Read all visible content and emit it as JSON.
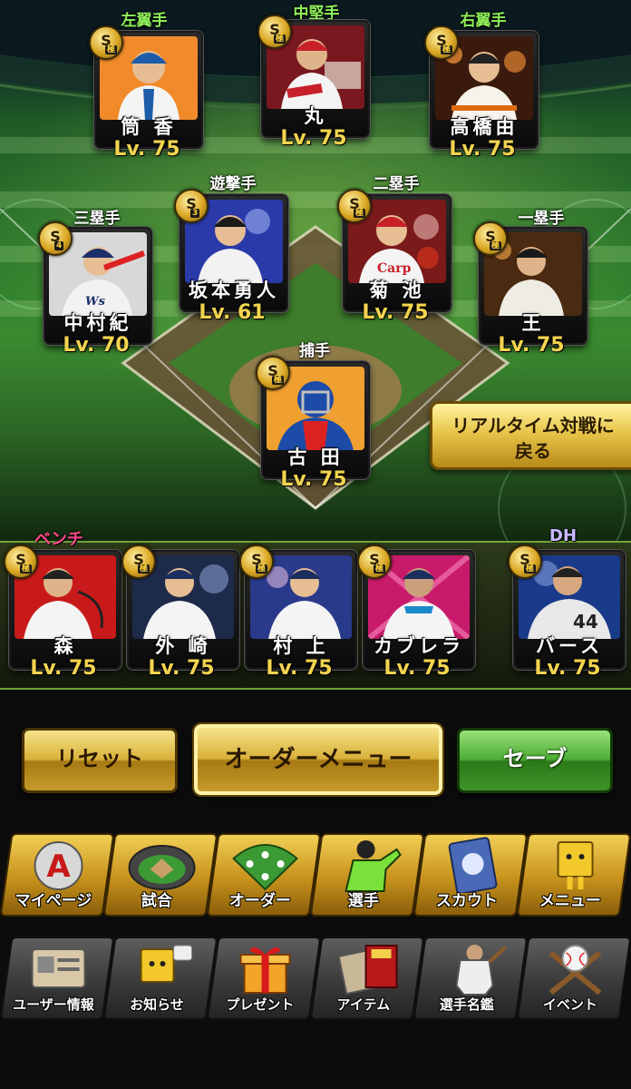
{
  "lineup": {
    "left_field": {
      "position": "左翼手",
      "name": "筒 香",
      "level": "Lv. 75",
      "badge": "S",
      "badge_sub": "極",
      "jersey": "#1c5ca8"
    },
    "center_field": {
      "position": "中堅手",
      "name": "丸",
      "level": "Lv. 75",
      "badge": "S",
      "badge_sub": "極",
      "jersey": "#c8202a"
    },
    "right_field": {
      "position": "右翼手",
      "name": "高橋由",
      "level": "Lv. 75",
      "badge": "S",
      "badge_sub": "極",
      "jersey": "#2a2a2a"
    },
    "third_base": {
      "position": "三塁手",
      "name": "中村紀",
      "level": "Lv. 70",
      "badge": "S",
      "badge_sub": "4",
      "jersey": "#1d2f6b"
    },
    "shortstop": {
      "position": "遊撃手",
      "name": "坂本勇人",
      "level": "Lv. 61",
      "badge": "S",
      "badge_sub": "3",
      "jersey": "#2a2a2a"
    },
    "second_base": {
      "position": "二塁手",
      "name": "菊 池",
      "level": "Lv. 75",
      "badge": "S",
      "badge_sub": "極",
      "jersey": "#c8202a"
    },
    "first_base": {
      "position": "一塁手",
      "name": "王",
      "level": "Lv. 75",
      "badge": "S",
      "badge_sub": "極",
      "jersey": "#2a2a2a"
    },
    "catcher": {
      "position": "捕手",
      "name": "古 田",
      "level": "Lv. 75",
      "badge": "S",
      "badge_sub": "極",
      "jersey": "#1c4ba8"
    }
  },
  "bench": {
    "label": "ベンチ",
    "players": [
      {
        "name": "森",
        "level": "Lv. 75",
        "badge": "S",
        "badge_sub": "極",
        "jersey": "#d8202a"
      },
      {
        "name": "外 崎",
        "level": "Lv. 75",
        "badge": "S",
        "badge_sub": "極",
        "jersey": "#1b2f5e"
      },
      {
        "name": "村 上",
        "level": "Lv. 75",
        "badge": "S",
        "badge_sub": "極",
        "jersey": "#1b2f5e"
      },
      {
        "name": "カブレラ",
        "level": "Lv. 75",
        "badge": "S",
        "badge_sub": "極",
        "jersey": "#1b8ac8"
      }
    ],
    "dh_label": "DH",
    "dh": {
      "name": "バース",
      "level": "Lv. 75",
      "badge": "S",
      "badge_sub": "極",
      "jersey": "#d8d8d8"
    }
  },
  "realtime_button": {
    "line1": "リアルタイム対戦に",
    "line2": "戻る"
  },
  "actions": {
    "reset": "リセット",
    "order_menu": "オーダーメニュー",
    "save": "セーブ"
  },
  "nav_primary": [
    {
      "label": "マイページ",
      "icon": "mypage-icon"
    },
    {
      "label": "試合",
      "icon": "stadium-icon"
    },
    {
      "label": "オーダー",
      "icon": "order-icon"
    },
    {
      "label": "選手",
      "icon": "player-icon"
    },
    {
      "label": "スカウト",
      "icon": "scout-icon"
    },
    {
      "label": "メニュー",
      "icon": "menu-icon"
    }
  ],
  "nav_secondary": [
    {
      "label": "ユーザー情報",
      "icon": "user-info-icon"
    },
    {
      "label": "お知らせ",
      "icon": "news-icon"
    },
    {
      "label": "プレゼント",
      "icon": "present-icon"
    },
    {
      "label": "アイテム",
      "icon": "item-icon"
    },
    {
      "label": "選手名鑑",
      "icon": "player-guide-icon"
    },
    {
      "label": "イベント",
      "icon": "event-icon"
    }
  ],
  "colors": {
    "accent_gold": "#f3d44f",
    "outfield_label": "#8ff05a",
    "bench_label": "#ff4a8a",
    "dh_label": "#c9b8ff",
    "save_green": "#4cae34"
  }
}
